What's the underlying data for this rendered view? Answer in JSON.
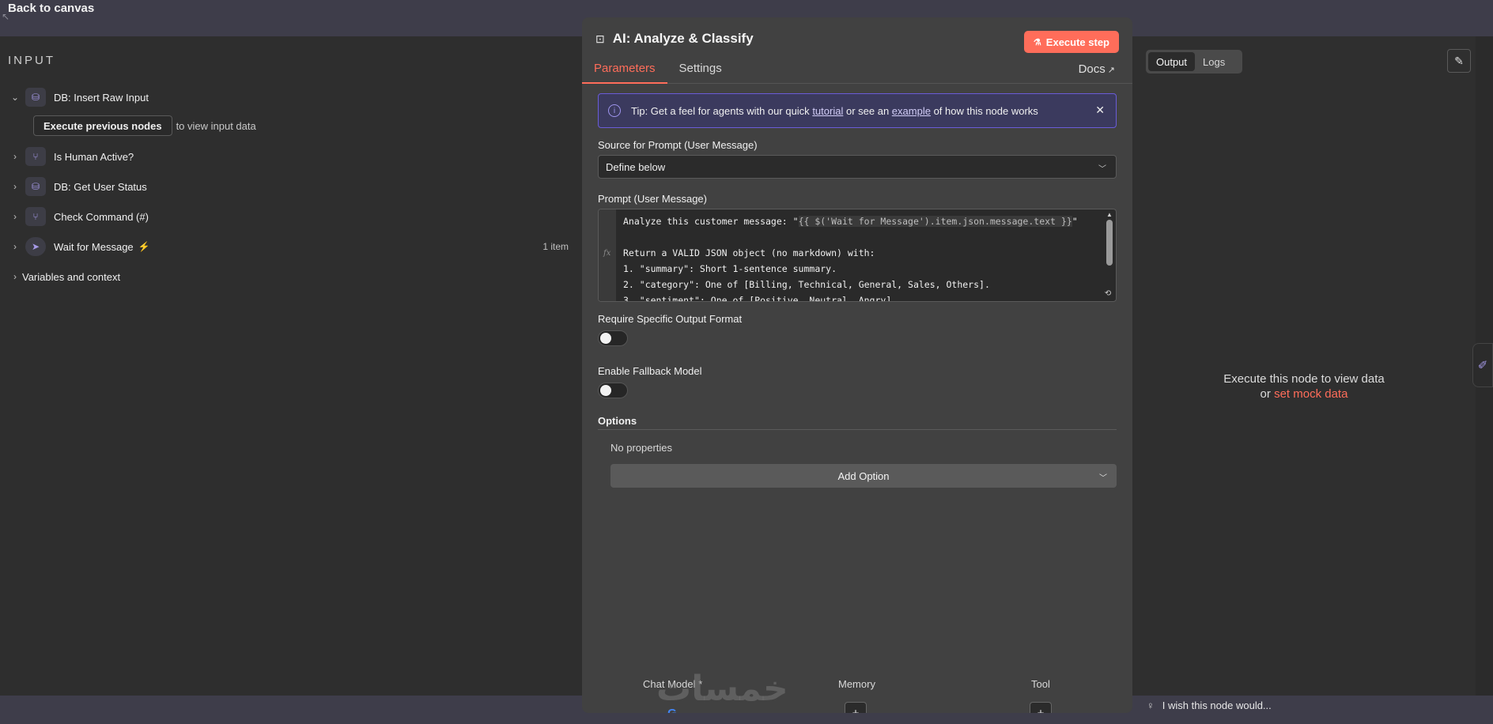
{
  "topbar": {
    "back_label": "Back to canvas"
  },
  "input_panel": {
    "title": "INPUT",
    "nodes": [
      {
        "label": "DB: Insert Raw Input",
        "icon": "database-icon",
        "expanded": true
      },
      {
        "label": "Is Human Active?",
        "icon": "if-branch-icon"
      },
      {
        "label": "DB: Get User Status",
        "icon": "database-icon"
      },
      {
        "label": "Check Command (#)",
        "icon": "if-branch-icon"
      },
      {
        "label": "Wait for Message",
        "icon": "telegram-icon",
        "item_count": "1 item"
      }
    ],
    "execute_previous_label": "Execute previous nodes",
    "execute_previous_suffix": "to view input data",
    "variables_label": "Variables and context"
  },
  "modal": {
    "title": "AI: Analyze & Classify",
    "execute_step_label": "Execute step",
    "tabs": [
      {
        "label": "Parameters",
        "active": true
      },
      {
        "label": "Settings",
        "active": false
      }
    ],
    "docs_label": "Docs",
    "tip": {
      "prefix": "Tip: Get a feel for agents with our quick",
      "link1": "tutorial",
      "middle": "or see an",
      "link2": "example",
      "suffix": "of how this node works"
    },
    "source_label": "Source for Prompt (User Message)",
    "source_value": "Define below",
    "prompt_label": "Prompt (User Message)",
    "prompt_line1_text": "Analyze this customer message: \"",
    "prompt_line1_expr": "{{ $('Wait for Message').item.json.message.text }}",
    "prompt_line1_end": "\"",
    "prompt_lines": [
      "",
      "Return a VALID JSON object (no markdown) with:",
      "1. \"summary\": Short 1-sentence summary.",
      "2. \"category\": One of [Billing, Technical, General, Sales, Others].",
      "3. \"sentiment\": One of [Positive, Neutral, Angry]"
    ],
    "require_format_label": "Require Specific Output Format",
    "fallback_label": "Enable Fallback Model",
    "options_label": "Options",
    "no_properties": "No properties",
    "add_option_label": "Add Option",
    "sub_nodes": {
      "chat_model": "Chat Model *",
      "memory": "Memory",
      "tool": "Tool"
    }
  },
  "output_panel": {
    "tabs": [
      {
        "label": "Output",
        "active": true
      },
      {
        "label": "Logs",
        "active": false
      }
    ],
    "message": "Execute this node to view data",
    "or_label": "or",
    "mock_link": "set mock data"
  },
  "footer": {
    "wish_label": "I wish this node would..."
  },
  "colors": {
    "accent": "#ff6d5a",
    "tip_border": "#6a5cd8",
    "panel": "#2e2e2e",
    "modal": "#414141"
  }
}
